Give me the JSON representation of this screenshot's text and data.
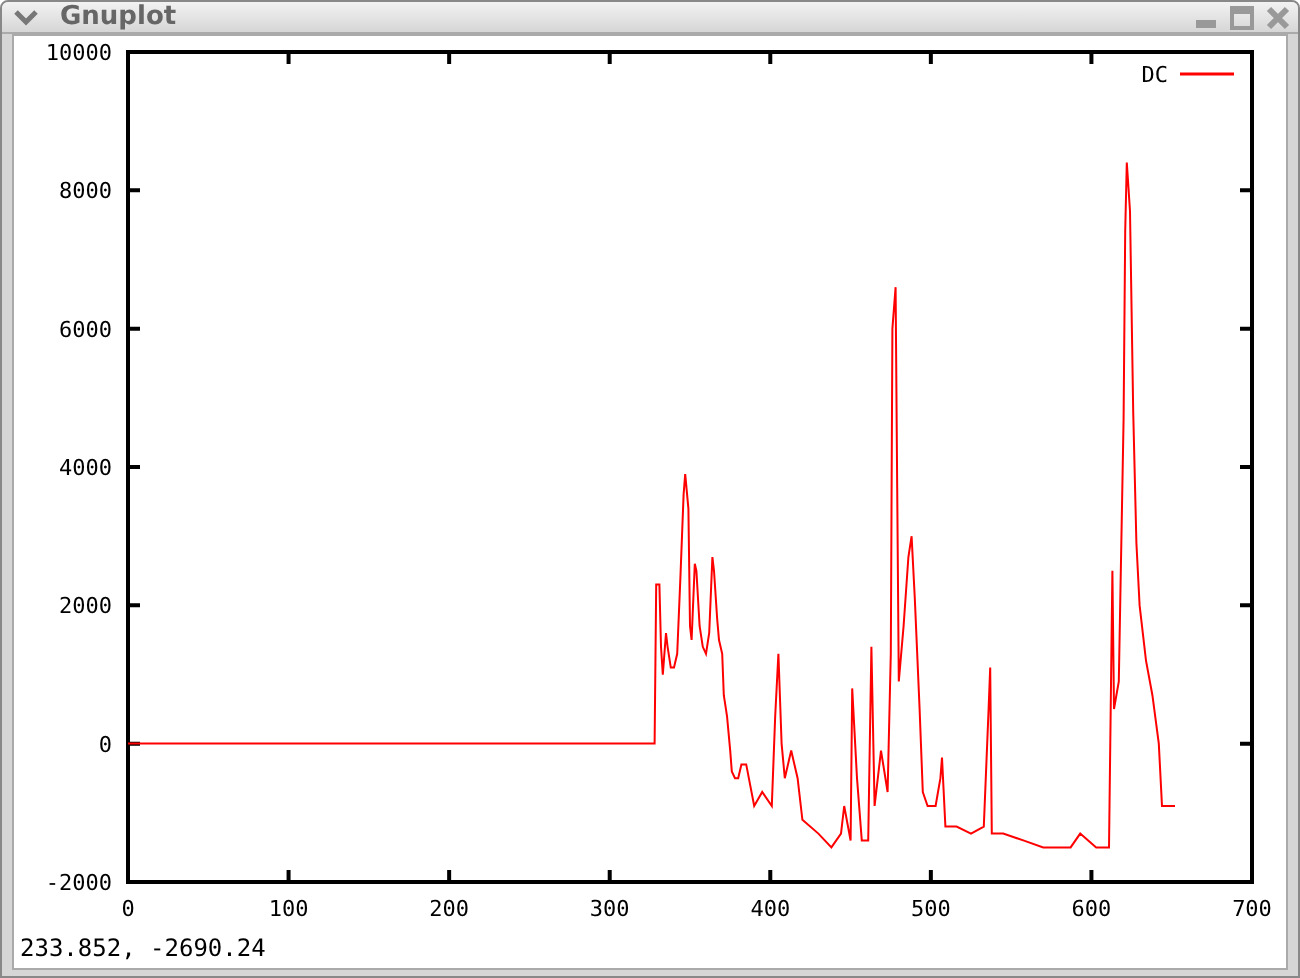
{
  "window": {
    "title": "Gnuplot"
  },
  "plot": {
    "chart_data": {
      "type": "line",
      "xlim": [
        0,
        700
      ],
      "ylim": [
        -2000,
        10000
      ],
      "xticks": [
        0,
        100,
        200,
        300,
        400,
        500,
        600,
        700
      ],
      "yticks": [
        -2000,
        0,
        2000,
        4000,
        6000,
        8000,
        10000
      ],
      "x": [
        0,
        328,
        329,
        331,
        332,
        333,
        335,
        336,
        338,
        340,
        342,
        344,
        346,
        347,
        349,
        350,
        351,
        353,
        354,
        356,
        358,
        360,
        362,
        364,
        365,
        367,
        368,
        370,
        371,
        373,
        375,
        376,
        378,
        380,
        382,
        385,
        390,
        395,
        401,
        403,
        405,
        407,
        409,
        413,
        417,
        420,
        430,
        438,
        444,
        446,
        450,
        451,
        454,
        457,
        461,
        463,
        465,
        469,
        473,
        475,
        476,
        478,
        479,
        480,
        483,
        486,
        488,
        490,
        493,
        495,
        498,
        503,
        506,
        507,
        509,
        516,
        525,
        533,
        536,
        537,
        538,
        545,
        558,
        570,
        587,
        593,
        603,
        611,
        613,
        614,
        617,
        620,
        621,
        622,
        624,
        626,
        628,
        630,
        634,
        638,
        642,
        644,
        648,
        652
      ],
      "series": [
        {
          "name": "DC",
          "color": "#ff0000",
          "values": [
            0,
            0,
            2300,
            2300,
            1400,
            1000,
            1600,
            1400,
            1100,
            1100,
            1300,
            2400,
            3600,
            3900,
            3400,
            1700,
            1500,
            2600,
            2500,
            1700,
            1400,
            1300,
            1600,
            2700,
            2500,
            1800,
            1500,
            1300,
            700,
            400,
            -100,
            -400,
            -500,
            -500,
            -300,
            -300,
            -900,
            -700,
            -900,
            400,
            1300,
            0,
            -500,
            -100,
            -500,
            -1100,
            -1300,
            -1500,
            -1300,
            -900,
            -1400,
            800,
            -500,
            -1400,
            -1400,
            1400,
            -900,
            -100,
            -700,
            1300,
            6000,
            6600,
            3700,
            900,
            1700,
            2700,
            3000,
            2100,
            500,
            -700,
            -900,
            -900,
            -500,
            -200,
            -1200,
            -1200,
            -1300,
            -1200,
            500,
            1100,
            -1300,
            -1300,
            -1400,
            -1500,
            -1500,
            -1300,
            -1500,
            -1500,
            2500,
            500,
            900,
            4700,
            7400,
            8400,
            7700,
            4800,
            2900,
            2000,
            1200,
            700,
            0,
            -900,
            -900,
            -900
          ]
        }
      ]
    }
  },
  "status_bar": {
    "text": "233.852, -2690.24"
  }
}
